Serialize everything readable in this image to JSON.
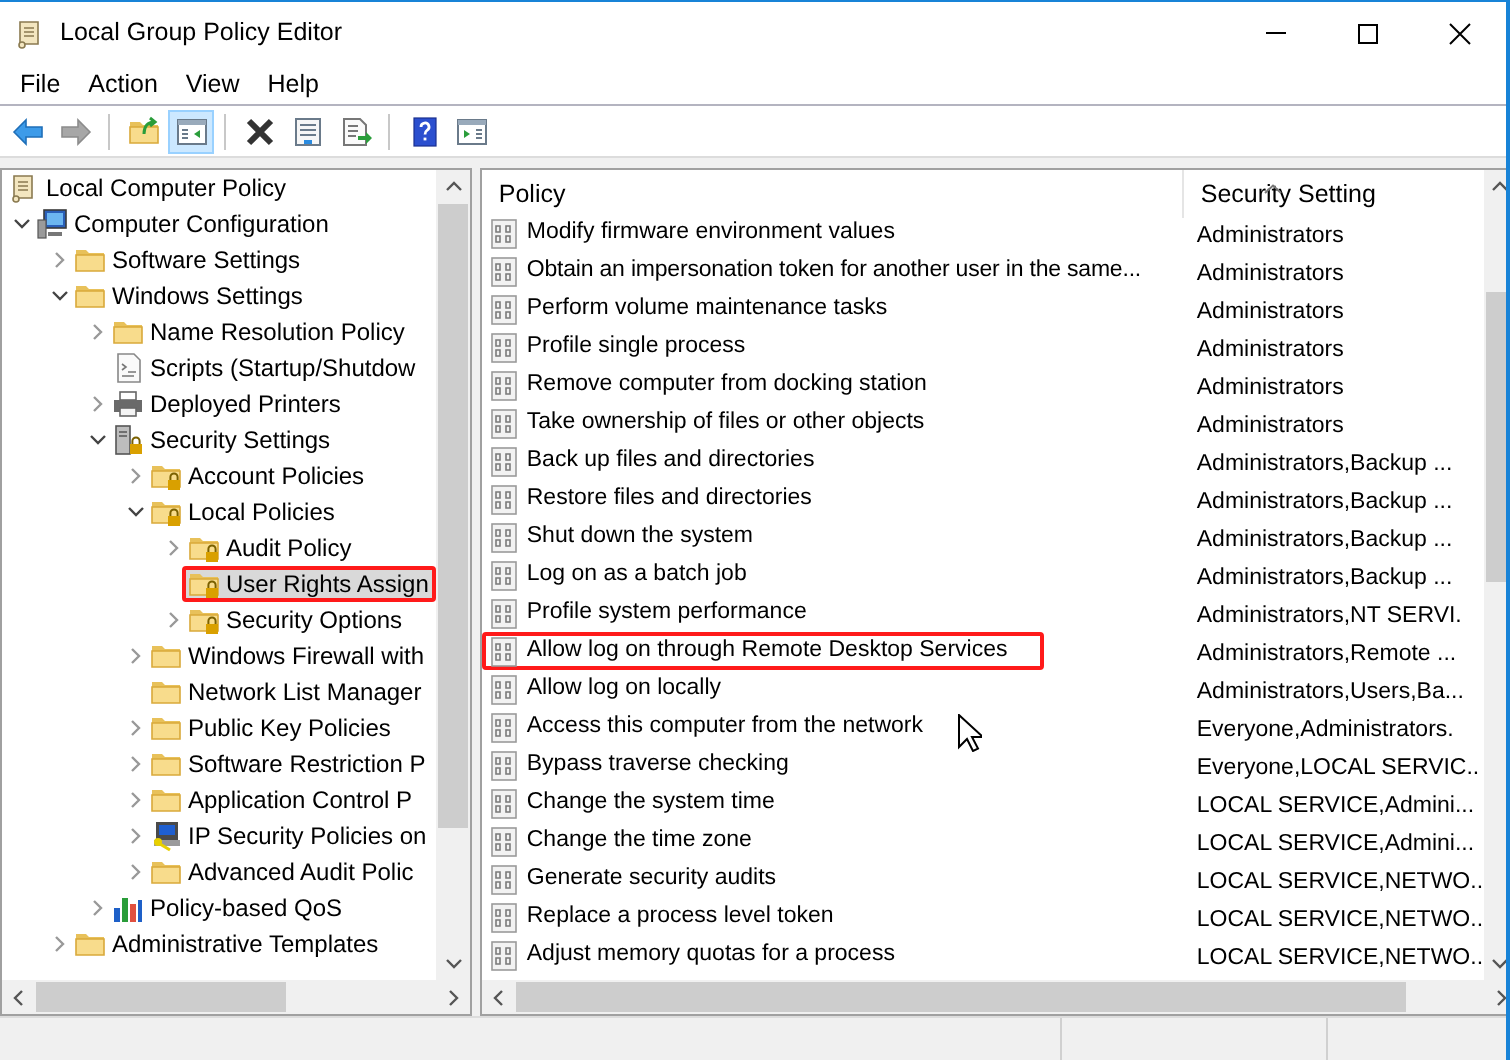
{
  "window": {
    "title": "Local Group Policy Editor"
  },
  "menu": [
    "File",
    "Action",
    "View",
    "Help"
  ],
  "toolbar": [
    {
      "kind": "back",
      "disabled": false,
      "pressed": false
    },
    {
      "kind": "forward",
      "disabled": true,
      "pressed": false
    },
    {
      "kind": "separator"
    },
    {
      "kind": "up",
      "disabled": false,
      "pressed": false
    },
    {
      "kind": "console-tree",
      "disabled": false,
      "pressed": true
    },
    {
      "kind": "separator"
    },
    {
      "kind": "delete",
      "disabled": false,
      "pressed": false
    },
    {
      "kind": "properties",
      "disabled": false,
      "pressed": false
    },
    {
      "kind": "export",
      "disabled": false,
      "pressed": false
    },
    {
      "kind": "separator"
    },
    {
      "kind": "help",
      "disabled": false,
      "pressed": false
    },
    {
      "kind": "action-pane",
      "disabled": false,
      "pressed": false
    }
  ],
  "tree": [
    {
      "label": "Local Computer Policy",
      "kind": "scroll",
      "selected": false,
      "annotated": false
    },
    {
      "label": "Computer Configuration",
      "kind": "computer",
      "expanded": true,
      "selected": false,
      "annotated": false,
      "children": [
        {
          "label": "Software Settings",
          "kind": "folder",
          "expanded": false,
          "selected": false,
          "annotated": false
        },
        {
          "label": "Windows Settings",
          "kind": "folder",
          "expanded": true,
          "selected": false,
          "annotated": false,
          "children": [
            {
              "label": "Name Resolution Policy",
              "kind": "folder",
              "expanded": false,
              "selected": false,
              "annotated": false
            },
            {
              "label": "Scripts (Startup/Shutdow",
              "kind": "script",
              "selected": false,
              "annotated": false
            },
            {
              "label": "Deployed Printers",
              "kind": "printer",
              "expanded": false,
              "selected": false,
              "annotated": false
            },
            {
              "label": "Security Settings",
              "kind": "server-lock",
              "expanded": true,
              "selected": false,
              "annotated": false,
              "children": [
                {
                  "label": "Account Policies",
                  "kind": "folder-lock",
                  "expanded": false,
                  "selected": false,
                  "annotated": false
                },
                {
                  "label": "Local Policies",
                  "kind": "folder-lock",
                  "expanded": true,
                  "selected": false,
                  "annotated": false,
                  "children": [
                    {
                      "label": "Audit Policy",
                      "kind": "folder-lock",
                      "expanded": false,
                      "selected": false,
                      "annotated": false
                    },
                    {
                      "label": "User Rights Assign",
                      "kind": "folder-lock",
                      "selected": true,
                      "annotated": true
                    },
                    {
                      "label": "Security Options",
                      "kind": "folder-lock",
                      "expanded": false,
                      "selected": false,
                      "annotated": false
                    }
                  ]
                },
                {
                  "label": "Windows Firewall with",
                  "kind": "folder",
                  "expanded": false,
                  "selected": false,
                  "annotated": false
                },
                {
                  "label": "Network List Manager",
                  "kind": "folder",
                  "selected": false,
                  "annotated": false
                },
                {
                  "label": "Public Key Policies",
                  "kind": "folder",
                  "expanded": false,
                  "selected": false,
                  "annotated": false
                },
                {
                  "label": "Software Restriction P",
                  "kind": "folder",
                  "expanded": false,
                  "selected": false,
                  "annotated": false
                },
                {
                  "label": "Application Control P",
                  "kind": "folder",
                  "expanded": false,
                  "selected": false,
                  "annotated": false
                },
                {
                  "label": "IP Security Policies on",
                  "kind": "computer-key",
                  "expanded": false,
                  "selected": false,
                  "annotated": false
                },
                {
                  "label": "Advanced Audit Polic",
                  "kind": "folder",
                  "expanded": false,
                  "selected": false,
                  "annotated": false
                }
              ]
            },
            {
              "label": "Policy-based QoS",
              "kind": "chart",
              "expanded": false,
              "selected": false,
              "annotated": false
            }
          ]
        },
        {
          "label": "Administrative Templates",
          "kind": "folder",
          "expanded": false,
          "selected": false,
          "annotated": false
        }
      ]
    }
  ],
  "table": {
    "columns": [
      {
        "label": "Policy",
        "sorted": false
      },
      {
        "label": "Security Setting",
        "sorted": true
      }
    ],
    "rows": [
      {
        "policy": "Modify firmware environment values",
        "setting": "Administrators",
        "annotated": false
      },
      {
        "policy": "Obtain an impersonation token for another user in the same...",
        "setting": "Administrators",
        "annotated": false
      },
      {
        "policy": "Perform volume maintenance tasks",
        "setting": "Administrators",
        "annotated": false
      },
      {
        "policy": "Profile single process",
        "setting": "Administrators",
        "annotated": false
      },
      {
        "policy": "Remove computer from docking station",
        "setting": "Administrators",
        "annotated": false
      },
      {
        "policy": "Take ownership of files or other objects",
        "setting": "Administrators",
        "annotated": false
      },
      {
        "policy": "Back up files and directories",
        "setting": "Administrators,Backup ...",
        "annotated": false
      },
      {
        "policy": "Restore files and directories",
        "setting": "Administrators,Backup ...",
        "annotated": false
      },
      {
        "policy": "Shut down the system",
        "setting": "Administrators,Backup ...",
        "annotated": false
      },
      {
        "policy": "Log on as a batch job",
        "setting": "Administrators,Backup ...",
        "annotated": false
      },
      {
        "policy": "Profile system performance",
        "setting": "Administrators,NT SERVI.",
        "annotated": false
      },
      {
        "policy": "Allow log on through Remote Desktop Services",
        "setting": "Administrators,Remote ...",
        "annotated": true
      },
      {
        "policy": "Allow log on locally",
        "setting": "Administrators,Users,Ba...",
        "annotated": false
      },
      {
        "policy": "Access this computer from the network",
        "setting": "Everyone,Administrators.",
        "annotated": false
      },
      {
        "policy": "Bypass traverse checking",
        "setting": "Everyone,LOCAL SERVIC..",
        "annotated": false
      },
      {
        "policy": "Change the system time",
        "setting": "LOCAL SERVICE,Admini...",
        "annotated": false
      },
      {
        "policy": "Change the time zone",
        "setting": "LOCAL SERVICE,Admini...",
        "annotated": false
      },
      {
        "policy": "Generate security audits",
        "setting": "LOCAL SERVICE,NETWO..",
        "annotated": false
      },
      {
        "policy": "Replace a process level token",
        "setting": "LOCAL SERVICE,NETWO..",
        "annotated": false
      },
      {
        "policy": "Adjust memory quotas for a process",
        "setting": "LOCAL SERVICE,NETWO..",
        "annotated": false
      }
    ]
  }
}
